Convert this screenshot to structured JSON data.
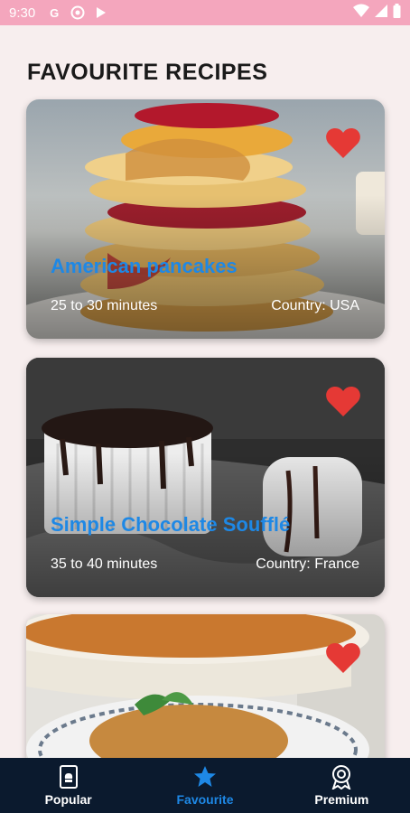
{
  "status_bar": {
    "time": "9:30",
    "icons": [
      "google-icon",
      "vpn-icon",
      "play-store-icon",
      "wifi-icon",
      "signal-icon",
      "battery-icon"
    ]
  },
  "page": {
    "title": "FAVOURITE RECIPES"
  },
  "recipes": [
    {
      "name": "American pancakes",
      "time": "25 to 30 minutes",
      "country": "Country: USA",
      "favourite": true
    },
    {
      "name": "Simple Chocolate Soufflé",
      "time": "35 to 40 minutes",
      "country": "Country: France",
      "favourite": true
    },
    {
      "name": "",
      "time": "",
      "country": "",
      "favourite": true
    }
  ],
  "bottom_nav": {
    "items": [
      {
        "label": "Popular",
        "icon": "cookbook-icon"
      },
      {
        "label": "Favourite",
        "icon": "star-icon",
        "active": true
      },
      {
        "label": "Premium",
        "icon": "medal-icon"
      }
    ]
  },
  "colors": {
    "accent": "#1e88e5",
    "heart": "#e53935",
    "status_bar": "#f4a6bd",
    "nav_bg": "#0b1a2e"
  }
}
